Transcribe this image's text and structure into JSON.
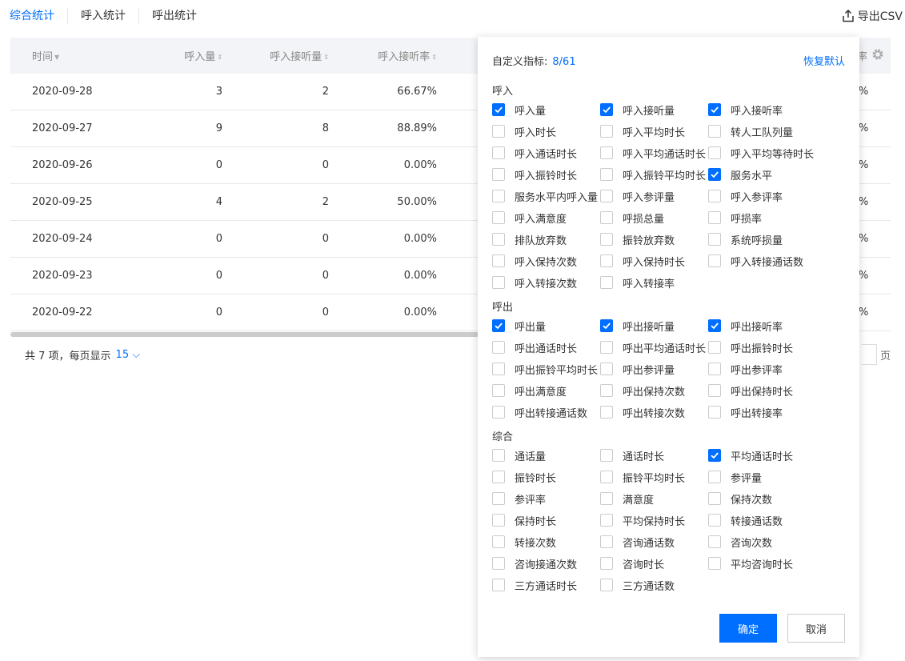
{
  "tabs": [
    "综合统计",
    "呼入统计",
    "呼出统计"
  ],
  "export_label": "导出CSV",
  "table": {
    "headers": [
      "时间",
      "呼入量",
      "呼入接听量",
      "呼入接听率"
    ],
    "partial_header": "率",
    "rows": [
      [
        "2020-09-28",
        "3",
        "2",
        "66.67%",
        "%"
      ],
      [
        "2020-09-27",
        "9",
        "8",
        "88.89%",
        "%"
      ],
      [
        "2020-09-26",
        "0",
        "0",
        "0.00%",
        "%"
      ],
      [
        "2020-09-25",
        "4",
        "2",
        "50.00%",
        "%"
      ],
      [
        "2020-09-24",
        "0",
        "0",
        "0.00%",
        "%"
      ],
      [
        "2020-09-23",
        "0",
        "0",
        "0.00%",
        "%"
      ],
      [
        "2020-09-22",
        "0",
        "0",
        "0.00%",
        "%"
      ]
    ]
  },
  "pager": {
    "text": "共 7 项，每页显示",
    "size": "15",
    "unit": "页"
  },
  "popup": {
    "title": "自定义指标:",
    "count": "8/61",
    "reset": "恢复默认",
    "groups": [
      {
        "label": "呼入",
        "items": [
          {
            "label": "呼入量",
            "checked": true
          },
          {
            "label": "呼入接听量",
            "checked": true
          },
          {
            "label": "呼入接听率",
            "checked": true
          },
          {
            "label": "呼入时长",
            "checked": false
          },
          {
            "label": "呼入平均时长",
            "checked": false
          },
          {
            "label": "转人工队列量",
            "checked": false
          },
          {
            "label": "呼入通话时长",
            "checked": false
          },
          {
            "label": "呼入平均通话时长",
            "checked": false
          },
          {
            "label": "呼入平均等待时长",
            "checked": false
          },
          {
            "label": "呼入振铃时长",
            "checked": false
          },
          {
            "label": "呼入振铃平均时长",
            "checked": false
          },
          {
            "label": "服务水平",
            "checked": true
          },
          {
            "label": "服务水平内呼入量",
            "checked": false
          },
          {
            "label": "呼入参评量",
            "checked": false
          },
          {
            "label": "呼入参评率",
            "checked": false
          },
          {
            "label": "呼入满意度",
            "checked": false
          },
          {
            "label": "呼损总量",
            "checked": false
          },
          {
            "label": "呼损率",
            "checked": false
          },
          {
            "label": "排队放弃数",
            "checked": false
          },
          {
            "label": "振铃放弃数",
            "checked": false
          },
          {
            "label": "系统呼损量",
            "checked": false
          },
          {
            "label": "呼入保持次数",
            "checked": false
          },
          {
            "label": "呼入保持时长",
            "checked": false
          },
          {
            "label": "呼入转接通话数",
            "checked": false
          },
          {
            "label": "呼入转接次数",
            "checked": false
          },
          {
            "label": "呼入转接率",
            "checked": false
          }
        ]
      },
      {
        "label": "呼出",
        "items": [
          {
            "label": "呼出量",
            "checked": true
          },
          {
            "label": "呼出接听量",
            "checked": true
          },
          {
            "label": "呼出接听率",
            "checked": true
          },
          {
            "label": "呼出通话时长",
            "checked": false
          },
          {
            "label": "呼出平均通话时长",
            "checked": false
          },
          {
            "label": "呼出振铃时长",
            "checked": false
          },
          {
            "label": "呼出振铃平均时长",
            "checked": false
          },
          {
            "label": "呼出参评量",
            "checked": false
          },
          {
            "label": "呼出参评率",
            "checked": false
          },
          {
            "label": "呼出满意度",
            "checked": false
          },
          {
            "label": "呼出保持次数",
            "checked": false
          },
          {
            "label": "呼出保持时长",
            "checked": false
          },
          {
            "label": "呼出转接通话数",
            "checked": false
          },
          {
            "label": "呼出转接次数",
            "checked": false
          },
          {
            "label": "呼出转接率",
            "checked": false
          }
        ]
      },
      {
        "label": "综合",
        "items": [
          {
            "label": "通话量",
            "checked": false
          },
          {
            "label": "通话时长",
            "checked": false
          },
          {
            "label": "平均通话时长",
            "checked": true
          },
          {
            "label": "振铃时长",
            "checked": false
          },
          {
            "label": "振铃平均时长",
            "checked": false
          },
          {
            "label": "参评量",
            "checked": false
          },
          {
            "label": "参评率",
            "checked": false
          },
          {
            "label": "满意度",
            "checked": false
          },
          {
            "label": "保持次数",
            "checked": false
          },
          {
            "label": "保持时长",
            "checked": false
          },
          {
            "label": "平均保持时长",
            "checked": false
          },
          {
            "label": "转接通话数",
            "checked": false
          },
          {
            "label": "转接次数",
            "checked": false
          },
          {
            "label": "咨询通话数",
            "checked": false
          },
          {
            "label": "咨询次数",
            "checked": false
          },
          {
            "label": "咨询接通次数",
            "checked": false
          },
          {
            "label": "咨询时长",
            "checked": false
          },
          {
            "label": "平均咨询时长",
            "checked": false
          },
          {
            "label": "三方通话时长",
            "checked": false
          },
          {
            "label": "三方通话数",
            "checked": false
          }
        ]
      }
    ],
    "ok": "确定",
    "cancel": "取消"
  },
  "colors": {
    "accent": "#006eff"
  }
}
